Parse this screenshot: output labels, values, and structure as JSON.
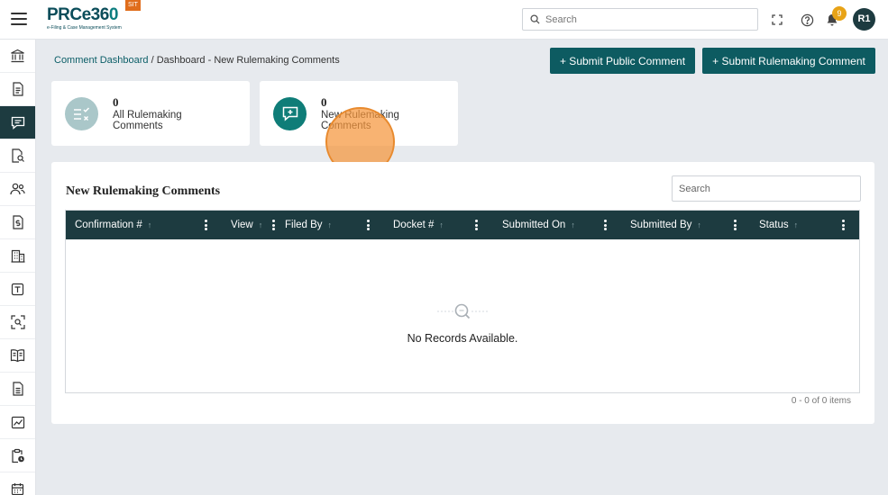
{
  "header": {
    "logo_main": "PRCe36",
    "logo_tail": "0",
    "logo_sub": "e-Filing & Case Management System",
    "env_badge": "SIT",
    "search_placeholder": "Search",
    "notification_count": "9",
    "user_initials": "R1"
  },
  "breadcrumb": {
    "root": "Comment Dashboard",
    "separator": " / ",
    "current": "Dashboard - New Rulemaking Comments"
  },
  "actions": {
    "submit_public": "+ Submit Public Comment",
    "submit_rulemaking": "+ Submit Rulemaking Comment"
  },
  "cards": [
    {
      "count": "0",
      "label": "All Rulemaking Comments"
    },
    {
      "count": "0",
      "label": "New Rulemaking Comments"
    }
  ],
  "panel": {
    "title": "New Rulemaking Comments",
    "search_placeholder": "Search"
  },
  "grid": {
    "columns": [
      {
        "label": "Confirmation #",
        "sort": "↑"
      },
      {
        "label": "View",
        "sort": "↑"
      },
      {
        "label": "Filed By",
        "sort": "↑"
      },
      {
        "label": "Docket #",
        "sort": "↑"
      },
      {
        "label": "Submitted On",
        "sort": "↑"
      },
      {
        "label": "Submitted By",
        "sort": "↑"
      },
      {
        "label": "Status",
        "sort": "↑"
      }
    ],
    "empty_text": "No Records Available.",
    "pager": "0 - 0 of 0 items"
  },
  "sidebar": {
    "items": [
      {
        "icon": "institution-icon"
      },
      {
        "icon": "document-icon"
      },
      {
        "icon": "comment-icon",
        "active": true
      },
      {
        "icon": "document-search-icon"
      },
      {
        "icon": "users-icon"
      },
      {
        "icon": "money-document-icon"
      },
      {
        "icon": "building-icon"
      },
      {
        "icon": "template-icon"
      },
      {
        "icon": "scan-search-icon"
      },
      {
        "icon": "book-icon"
      },
      {
        "icon": "report-document-icon"
      },
      {
        "icon": "chart-icon"
      },
      {
        "icon": "clipboard-clock-icon"
      },
      {
        "icon": "calendar-icon"
      }
    ]
  },
  "colors": {
    "primary": "#0d5b61",
    "header_dark": "#1d3b40",
    "badge": "#e8a317",
    "env": "#e06d1c"
  }
}
